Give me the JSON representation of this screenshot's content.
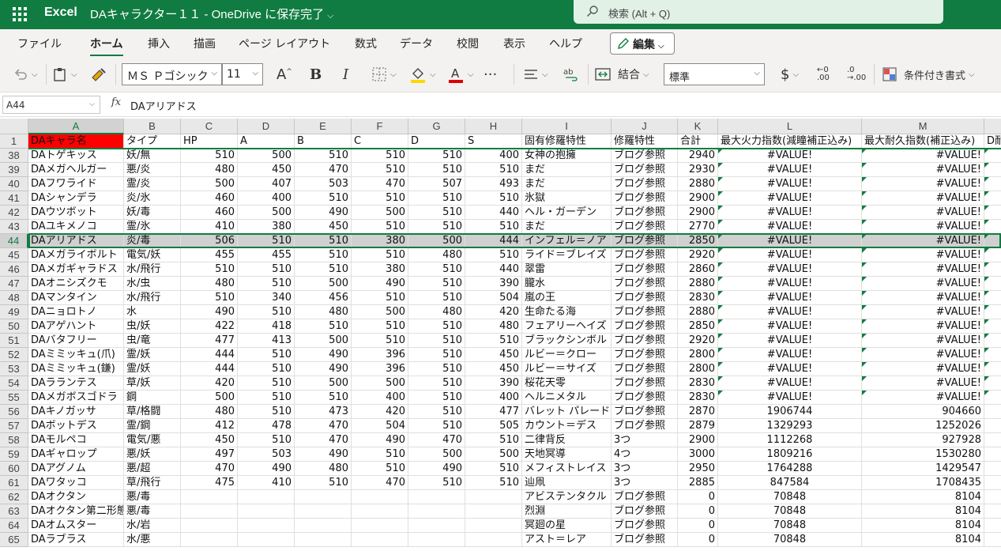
{
  "titlebar": {
    "app_name": "Excel",
    "document_title": "DAキャラクター１１ - OneDrive に保存完了",
    "search_placeholder": "検索 (Alt + Q)",
    "color": "#107c41"
  },
  "menu": {
    "items": [
      "ファイル",
      "ホーム",
      "挿入",
      "描画",
      "ページ レイアウト",
      "数式",
      "データ",
      "校閲",
      "表示",
      "ヘルプ"
    ],
    "active": "ホーム",
    "edit_label": "編集"
  },
  "ribbon": {
    "font_name": "ＭＳ Ｐゴシック",
    "font_size": "11",
    "merge_label": "結合",
    "number_format": "標準",
    "conditional_format_label": "条件付き書式",
    "icons": [
      "undo-icon",
      "paste-icon",
      "format-painter-icon",
      "increase-font-icon",
      "bold-icon",
      "italic-icon",
      "borders-icon",
      "fill-color-icon",
      "font-color-icon",
      "more-icon",
      "align-icon",
      "wrap-icon",
      "merge-icon",
      "currency-icon",
      "decrease-decimal-icon",
      "increase-decimal-icon",
      "conditional-format-icon"
    ],
    "fill_color": "#ffd800",
    "font_color": "#e00000"
  },
  "formula_bar": {
    "name_box": "A44",
    "fx_label": "fx",
    "formula": "DAアリアドス"
  },
  "sheet": {
    "columns": [
      "A",
      "B",
      "C",
      "D",
      "E",
      "F",
      "G",
      "H",
      "I",
      "J",
      "K",
      "L",
      "M",
      ""
    ],
    "header_row": {
      "num": "1",
      "cells": [
        "DAキャラ名",
        "タイプ",
        "HP",
        "A",
        "B",
        "C",
        "D",
        "S",
        "固有修羅特性",
        "修羅特性",
        "合計",
        "最大火力指数(減瞳補正込み)",
        "最大耐久指数(補正込み)",
        "D耐"
      ]
    },
    "rows": [
      {
        "num": "38",
        "cells": [
          "DAトゲキッス",
          "妖/無",
          "510",
          "500",
          "510",
          "510",
          "510",
          "400",
          "女神の抱擁",
          "ブログ参照",
          "2940",
          "#VALUE!",
          "#VALUE!",
          ""
        ]
      },
      {
        "num": "39",
        "cells": [
          "DAメガヘルガー",
          "悪/炎",
          "480",
          "450",
          "470",
          "510",
          "510",
          "510",
          "まだ",
          "ブログ参照",
          "2930",
          "#VALUE!",
          "#VALUE!",
          ""
        ]
      },
      {
        "num": "40",
        "cells": [
          "DAフワライド",
          "霊/炎",
          "500",
          "407",
          "503",
          "470",
          "507",
          "493",
          "まだ",
          "ブログ参照",
          "2880",
          "#VALUE!",
          "#VALUE!",
          ""
        ]
      },
      {
        "num": "41",
        "cells": [
          "DAシャンデラ",
          "炎/氷",
          "460",
          "400",
          "510",
          "510",
          "510",
          "510",
          "氷獄",
          "ブログ参照",
          "2900",
          "#VALUE!",
          "#VALUE!",
          ""
        ]
      },
      {
        "num": "42",
        "cells": [
          "DAウツボット",
          "妖/毒",
          "460",
          "500",
          "490",
          "500",
          "510",
          "440",
          "ヘル・ガーデン",
          "ブログ参照",
          "2900",
          "#VALUE!",
          "#VALUE!",
          ""
        ]
      },
      {
        "num": "43",
        "cells": [
          "DAユキメノコ",
          "霊/氷",
          "410",
          "380",
          "450",
          "510",
          "510",
          "510",
          "まだ",
          "ブログ参照",
          "2770",
          "#VALUE!",
          "#VALUE!",
          ""
        ]
      },
      {
        "num": "44",
        "cells": [
          "DAアリアドス",
          "炎/毒",
          "506",
          "510",
          "510",
          "380",
          "500",
          "444",
          "インフェル＝ノア",
          "ブログ参照",
          "2850",
          "#VALUE!",
          "#VALUE!",
          ""
        ]
      },
      {
        "num": "45",
        "cells": [
          "DAメガライボルト",
          "電気/妖",
          "455",
          "455",
          "510",
          "510",
          "480",
          "510",
          "ライド＝ブレイズ",
          "ブログ参照",
          "2920",
          "#VALUE!",
          "#VALUE!",
          ""
        ]
      },
      {
        "num": "46",
        "cells": [
          "DAメガギャラドス",
          "水/飛行",
          "510",
          "510",
          "510",
          "380",
          "510",
          "440",
          "翠雷",
          "ブログ参照",
          "2860",
          "#VALUE!",
          "#VALUE!",
          ""
        ]
      },
      {
        "num": "47",
        "cells": [
          "DAオニシズクモ",
          "水/虫",
          "480",
          "510",
          "500",
          "490",
          "510",
          "390",
          "朧水",
          "ブログ参照",
          "2880",
          "#VALUE!",
          "#VALUE!",
          ""
        ]
      },
      {
        "num": "48",
        "cells": [
          "DAマンタイン",
          "水/飛行",
          "510",
          "340",
          "456",
          "510",
          "510",
          "504",
          "嵐の王",
          "ブログ参照",
          "2830",
          "#VALUE!",
          "#VALUE!",
          ""
        ]
      },
      {
        "num": "49",
        "cells": [
          "DAニョロトノ",
          "水",
          "490",
          "510",
          "480",
          "500",
          "480",
          "420",
          "生命たる海",
          "ブログ参照",
          "2880",
          "#VALUE!",
          "#VALUE!",
          ""
        ]
      },
      {
        "num": "50",
        "cells": [
          "DAアゲハント",
          "虫/妖",
          "422",
          "418",
          "510",
          "510",
          "510",
          "480",
          "フェアリーヘイズ",
          "ブログ参照",
          "2850",
          "#VALUE!",
          "#VALUE!",
          ""
        ]
      },
      {
        "num": "51",
        "cells": [
          "DAバタフリー",
          "虫/竜",
          "477",
          "413",
          "500",
          "510",
          "510",
          "510",
          "ブラックシンボル",
          "ブログ参照",
          "2920",
          "#VALUE!",
          "#VALUE!",
          ""
        ]
      },
      {
        "num": "52",
        "cells": [
          "DAミミッキュ(爪)",
          "霊/妖",
          "444",
          "510",
          "490",
          "396",
          "510",
          "450",
          "ルビー＝クロー",
          "ブログ参照",
          "2800",
          "#VALUE!",
          "#VALUE!",
          ""
        ]
      },
      {
        "num": "53",
        "cells": [
          "DAミミッキュ(鎌)",
          "霊/妖",
          "444",
          "510",
          "490",
          "396",
          "510",
          "450",
          "ルビー＝サイズ",
          "ブログ参照",
          "2800",
          "#VALUE!",
          "#VALUE!",
          ""
        ]
      },
      {
        "num": "54",
        "cells": [
          "DAラランテス",
          "草/妖",
          "420",
          "510",
          "500",
          "500",
          "510",
          "390",
          "桜花天零",
          "ブログ参照",
          "2830",
          "#VALUE!",
          "#VALUE!",
          ""
        ]
      },
      {
        "num": "55",
        "cells": [
          "DAメガボスゴドラ",
          "鋼",
          "500",
          "510",
          "510",
          "400",
          "510",
          "400",
          "ヘルニメタル",
          "ブログ参照",
          "2830",
          "#VALUE!",
          "#VALUE!",
          ""
        ]
      },
      {
        "num": "56",
        "cells": [
          "DAキノガッサ",
          "草/格闘",
          "480",
          "510",
          "473",
          "420",
          "510",
          "477",
          "バレット パレード",
          "ブログ参照",
          "2870",
          "1906744",
          "904660",
          ""
        ]
      },
      {
        "num": "57",
        "cells": [
          "DAボットデス",
          "霊/鋼",
          "412",
          "478",
          "470",
          "504",
          "510",
          "505",
          "カウント＝デス",
          "ブログ参照",
          "2879",
          "1329293",
          "1252026",
          ""
        ]
      },
      {
        "num": "58",
        "cells": [
          "DAモルペコ",
          "電気/悪",
          "450",
          "510",
          "470",
          "490",
          "470",
          "510",
          "二律背反",
          "3つ",
          "2900",
          "1112268",
          "927928",
          ""
        ]
      },
      {
        "num": "59",
        "cells": [
          "DAギャロップ",
          "悪/妖",
          "497",
          "503",
          "490",
          "510",
          "500",
          "500",
          "天地冥導",
          "4つ",
          "3000",
          "1809216",
          "1530280",
          ""
        ]
      },
      {
        "num": "60",
        "cells": [
          "DAアグノム",
          "悪/超",
          "470",
          "490",
          "480",
          "510",
          "490",
          "510",
          "メフィストレイス",
          "3つ",
          "2950",
          "1764288",
          "1429547",
          ""
        ]
      },
      {
        "num": "61",
        "cells": [
          "DAワタッコ",
          "草/飛行",
          "475",
          "410",
          "510",
          "470",
          "510",
          "510",
          "辿凧",
          "3つ",
          "2885",
          "847584",
          "1708435",
          ""
        ]
      },
      {
        "num": "62",
        "cells": [
          "DAオクタン",
          "悪/毒",
          "",
          "",
          "",
          "",
          "",
          "",
          "アビステンタクル",
          "ブログ参照",
          "0",
          "70848",
          "8104",
          ""
        ]
      },
      {
        "num": "63",
        "cells": [
          "DAオクタン第二形態",
          "悪/毒",
          "",
          "",
          "",
          "",
          "",
          "",
          "烈淵",
          "ブログ参照",
          "0",
          "70848",
          "8104",
          ""
        ]
      },
      {
        "num": "64",
        "cells": [
          "DAオムスター",
          "水/岩",
          "",
          "",
          "",
          "",
          "",
          "",
          "冥廻の星",
          "ブログ参照",
          "0",
          "70848",
          "8104",
          ""
        ]
      },
      {
        "num": "65",
        "cells": [
          "DAラブラス",
          "水/悪",
          "",
          "",
          "",
          "",
          "",
          "",
          "アスト＝レア",
          "ブログ参照",
          "0",
          "70848",
          "8104",
          ""
        ]
      }
    ],
    "selected_row": "44",
    "selected_col": "A",
    "accent_color": "#107c41",
    "header_fill": "#ff0000"
  }
}
